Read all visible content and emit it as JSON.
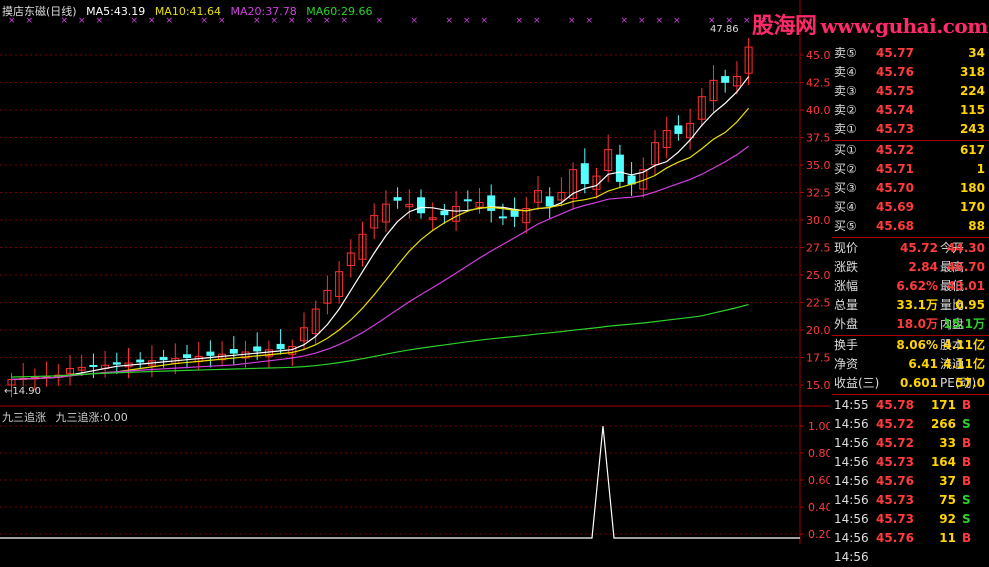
{
  "header": {
    "title": "摸店东磁(日线)",
    "ma5": "MA5:43.19",
    "ma10": "MA10:41.64",
    "ma20": "MA20:37.78",
    "ma60": "MA60:29.66"
  },
  "indicator": {
    "name": "九三追涨",
    "value_label": "九三追涨:0.00",
    "ticks": [
      "1.00",
      "0.80",
      "0.60",
      "0.40",
      "0.20"
    ]
  },
  "watermark": {
    "cn": "股海网",
    "url": "www.guhai.com.cn"
  },
  "price_axis": [
    "45.00",
    "42.50",
    "40.00",
    "37.50",
    "35.00",
    "32.50",
    "30.00",
    "27.50",
    "25.00",
    "22.50",
    "20.00",
    "17.50",
    "15.00"
  ],
  "price_markers": {
    "high": "47.86",
    "low": "←14.90"
  },
  "colors": {
    "up": "#ff3030",
    "down": "#54ffff",
    "ma5": "#ffffff",
    "ma10": "#e8e000",
    "ma20": "#d040e0",
    "ma60": "#2cd22c",
    "grid": "#7a0000",
    "marker": "#d040e0"
  },
  "order_book": [
    {
      "label": "卖⑤",
      "price": "45.77",
      "vol": "34"
    },
    {
      "label": "卖④",
      "price": "45.76",
      "vol": "318"
    },
    {
      "label": "卖③",
      "price": "45.75",
      "vol": "224"
    },
    {
      "label": "卖②",
      "price": "45.74",
      "vol": "115"
    },
    {
      "label": "卖①",
      "price": "45.73",
      "vol": "243"
    },
    {
      "label": "买①",
      "price": "45.72",
      "vol": "617"
    },
    {
      "label": "买②",
      "price": "45.71",
      "vol": "1"
    },
    {
      "label": "买③",
      "price": "45.70",
      "vol": "180"
    },
    {
      "label": "买④",
      "price": "45.69",
      "vol": "170"
    },
    {
      "label": "买⑤",
      "price": "45.68",
      "vol": "88"
    }
  ],
  "quote": [
    {
      "l1": "现价",
      "v1": "45.72",
      "c1": "#ff3b3b",
      "l2": "今开",
      "v2": "44.30",
      "c2": "#ff3b3b"
    },
    {
      "l1": "涨跌",
      "v1": "2.84",
      "c1": "#ff3b3b",
      "l2": "最高",
      "v2": "46.70",
      "c2": "#ff3b3b"
    },
    {
      "l1": "涨幅",
      "v1": "6.62%",
      "c1": "#ff3b3b",
      "l2": "最低",
      "v2": "43.01",
      "c2": "#ff3b3b"
    },
    {
      "l1": "总量",
      "v1": "33.1万",
      "c1": "#ffd400",
      "l2": "量比",
      "v2": "0.95",
      "c2": "#ffd400"
    },
    {
      "l1": "外盘",
      "v1": "18.0万",
      "c1": "#ff3b3b",
      "l2": "内盘",
      "v2": "15.1万",
      "c2": "#2cd22c"
    },
    {
      "l1": "换手",
      "v1": "8.06%",
      "c1": "#ffd400",
      "l2": "股本",
      "v2": "4.11亿",
      "c2": "#ffd400"
    },
    {
      "l1": "净资",
      "v1": "6.41",
      "c1": "#ffd400",
      "l2": "流通",
      "v2": "4.11亿",
      "c2": "#ffd400"
    },
    {
      "l1": "收益(三)",
      "v1": "0.601",
      "c1": "#ffd400",
      "l2": "PE(动)",
      "v2": "57.0",
      "c2": "#ffd400"
    }
  ],
  "ticks": [
    {
      "time": "14:55",
      "price": "45.78",
      "vol": "171",
      "bs": "B",
      "bscolor": "#ff3b3b"
    },
    {
      "time": "14:56",
      "price": "45.72",
      "vol": "266",
      "bs": "S",
      "bscolor": "#2cd22c"
    },
    {
      "time": "14:56",
      "price": "45.72",
      "vol": "33",
      "bs": "B",
      "bscolor": "#ff3b3b"
    },
    {
      "time": "14:56",
      "price": "45.73",
      "vol": "164",
      "bs": "B",
      "bscolor": "#ff3b3b"
    },
    {
      "time": "14:56",
      "price": "45.76",
      "vol": "37",
      "bs": "B",
      "bscolor": "#ff3b3b"
    },
    {
      "time": "14:56",
      "price": "45.73",
      "vol": "75",
      "bs": "S",
      "bscolor": "#2cd22c"
    },
    {
      "time": "14:56",
      "price": "45.73",
      "vol": "92",
      "bs": "S",
      "bscolor": "#2cd22c"
    },
    {
      "time": "14:56",
      "price": "45.76",
      "vol": "11",
      "bs": "B",
      "bscolor": "#ff3b3b"
    },
    {
      "time": "14:56",
      "price": "",
      "vol": "",
      "bs": "",
      "bscolor": "#ff3b3b"
    }
  ]
}
